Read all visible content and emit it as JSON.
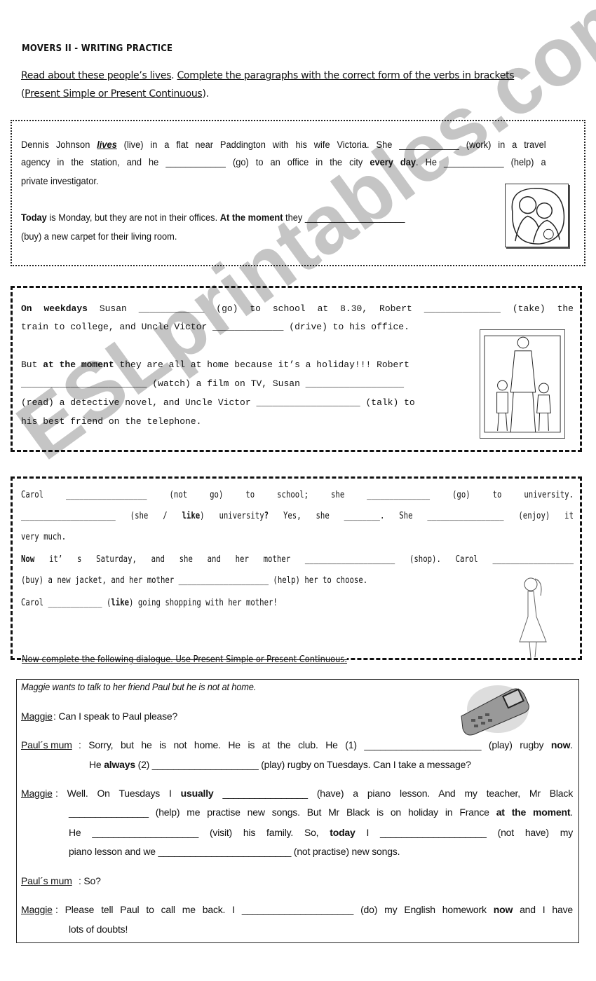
{
  "title": "MOVERS II - WRITING PRACTICE",
  "instructions": {
    "line1": [
      [
        "Read about these people’s lives",
        "u"
      ],
      [
        ". ",
        ""
      ],
      [
        "Complete the paragraphs with the correct form of the verbs in brackets",
        "u"
      ]
    ],
    "line2": [
      [
        "(",
        ""
      ],
      [
        "Present Simple or Present Continuous",
        "u"
      ],
      [
        ").",
        ""
      ]
    ]
  },
  "box1": {
    "lines": [
      {
        "j": true,
        "runs": [
          [
            "Dennis Johnson  ",
            ""
          ],
          [
            "lives",
            "biu"
          ],
          [
            "  (live) in a flat near Paddington with his wife Victoria. She ____________ (work) in a travel",
            ""
          ]
        ]
      },
      {
        "j": true,
        "runs": [
          [
            "agency in the station, and he ____________ (go) to an office in the city ",
            ""
          ],
          [
            "every day",
            "b"
          ],
          [
            ". He ____________ (help) a",
            ""
          ]
        ]
      },
      {
        "j": false,
        "runs": [
          [
            "private investigator.",
            ""
          ]
        ]
      },
      {
        "j": false,
        "runs": [
          [
            "Today",
            "b"
          ],
          [
            " is Monday, but they are not in their offices. ",
            ""
          ],
          [
            "At the moment",
            "b"
          ],
          [
            " they ____________________",
            ""
          ]
        ]
      },
      {
        "j": false,
        "runs": [
          [
            "(buy) a new carpet for their living room.",
            ""
          ]
        ]
      }
    ],
    "image": "couple-illustration"
  },
  "box2": {
    "lines": [
      {
        "j": true,
        "runs": [
          [
            "On weekdays",
            "b"
          ],
          [
            " Susan ____________ (go) to school at 8.30, Robert ______________ (take) the",
            ""
          ]
        ]
      },
      {
        "j": false,
        "runs": [
          [
            "train to college, and Uncle Victor _____________ (drive) to his office.",
            ""
          ]
        ]
      },
      {
        "j": false,
        "runs": [
          [
            "But ",
            ""
          ],
          [
            "at the moment",
            "b"
          ],
          [
            " they are all at home because it’s a holiday!!! Robert",
            ""
          ]
        ]
      },
      {
        "j": false,
        "runs": [
          [
            "_______________________ (watch) a film on TV, Susan __________________",
            ""
          ]
        ]
      },
      {
        "j": false,
        "runs": [
          [
            "(read) a detective novel, and Uncle Victor ___________________ (talk) to",
            ""
          ]
        ]
      },
      {
        "j": false,
        "runs": [
          [
            "his best friend on the telephone.",
            ""
          ]
        ]
      }
    ],
    "image": "family-illustration"
  },
  "box3": {
    "lines": [
      {
        "j": true,
        "runs": [
          [
            "Carol __________________ (not go) to school; she ______________ (go) to university.",
            ""
          ]
        ]
      },
      {
        "j": true,
        "runs": [
          [
            "_____________________ (she / ",
            ""
          ],
          [
            "like",
            "b"
          ],
          [
            ") university",
            ""
          ],
          [
            "?",
            "b"
          ],
          [
            " Yes, she ________. She _________________ (enjoy) it",
            ""
          ]
        ]
      },
      {
        "j": false,
        "runs": [
          [
            "very much.",
            ""
          ]
        ]
      },
      {
        "j": true,
        "runs": [
          [
            "Now",
            "b"
          ],
          [
            " it’ s Saturday, and she and her mother ____________________ (shop). Carol __________________",
            ""
          ]
        ]
      },
      {
        "j": false,
        "runs": [
          [
            "(buy) a new jacket, and her mother ____________________ (help) her to choose.",
            ""
          ]
        ]
      },
      {
        "j": false,
        "runs": [
          [
            "Carol ____________ (",
            ""
          ],
          [
            "like",
            "b"
          ],
          [
            ") going shopping with her mother!",
            ""
          ]
        ]
      }
    ],
    "image": "girl-illustration"
  },
  "dialogue_instruction": "Now complete the following dialogue. Use Present Simple or Present Continuous.",
  "box4": {
    "intro": "Maggie wants to talk to her friend Paul but he is not at home.",
    "lines": [
      {
        "speaker": "Maggie",
        "j": false,
        "runs": [
          [
            ": Can I speak to Paul please?",
            ""
          ]
        ]
      },
      {
        "speaker": "Paul´s mum",
        "j": true,
        "runs": [
          [
            ":    Sorry, but he is not home. He is at the club. He (1) ______________________ (play) rugby ",
            ""
          ],
          [
            "now",
            "b"
          ],
          [
            ".",
            ""
          ]
        ]
      },
      {
        "speaker": "",
        "j": false,
        "runs": [
          [
            "He ",
            ""
          ],
          [
            "always",
            "b"
          ],
          [
            " (2) ____________________ (play) rugby on Tuesdays. Can I take a message?",
            ""
          ]
        ]
      },
      {
        "speaker": "Maggie",
        "j": true,
        "runs": [
          [
            ":   Well. On Tuesdays I ",
            ""
          ],
          [
            "usually",
            "b"
          ],
          [
            " ________________ (have) a piano lesson. And my teacher, Mr Black",
            ""
          ]
        ]
      },
      {
        "speaker": "",
        "j": true,
        "runs": [
          [
            "_______________ (help) me practise new songs. But Mr Black is on holiday in France ",
            ""
          ],
          [
            "at the moment",
            "b"
          ],
          [
            ".",
            ""
          ]
        ]
      },
      {
        "speaker": "",
        "j": true,
        "runs": [
          [
            "He ____________________ (visit) his family. So, ",
            ""
          ],
          [
            "today",
            "b"
          ],
          [
            " I ____________________ (not have) my",
            ""
          ]
        ]
      },
      {
        "speaker": "",
        "j": false,
        "runs": [
          [
            "piano lesson and we _________________________ (not practise) new songs.",
            ""
          ]
        ]
      },
      {
        "speaker": "Paul´s mum",
        "j": false,
        "runs": [
          [
            ":  So?",
            ""
          ]
        ]
      },
      {
        "speaker": "Maggie",
        "j": true,
        "runs": [
          [
            ":   Please tell Paul to call me back. I _____________________ (do) my English homework ",
            ""
          ],
          [
            "now",
            "b"
          ],
          [
            " and I have",
            ""
          ]
        ]
      },
      {
        "speaker": "",
        "j": false,
        "runs": [
          [
            "lots of doubts!",
            ""
          ]
        ]
      }
    ],
    "image": "mobile-phone-illustration"
  },
  "watermark": "ESLprintables.com"
}
